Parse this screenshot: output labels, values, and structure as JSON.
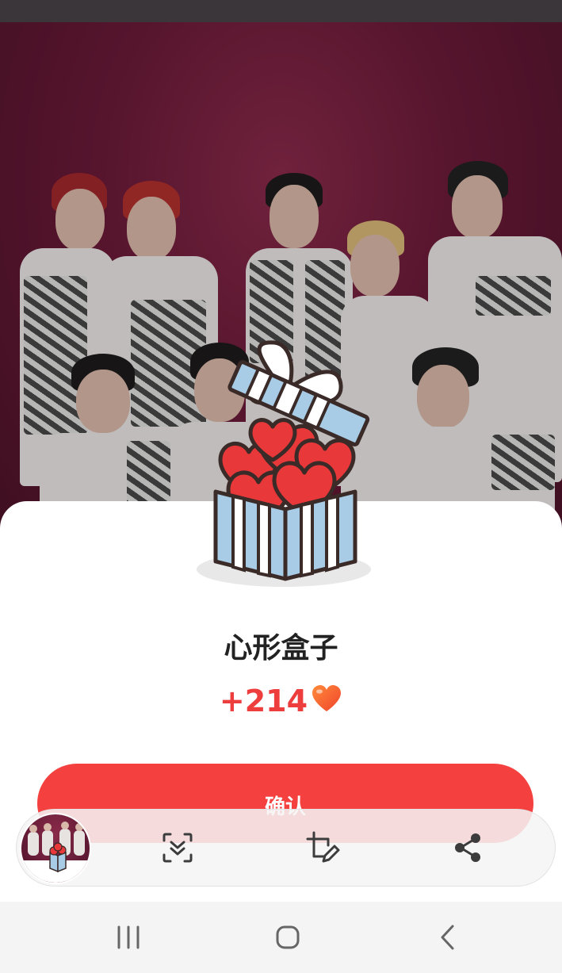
{
  "gift": {
    "name": "心形盒子",
    "reward": "+214"
  },
  "confirm_label": "确认",
  "toolbar": {
    "icons": [
      "scroll-capture-icon",
      "crop-edit-icon",
      "share-icon"
    ]
  },
  "navbar": {
    "icons": [
      "recents-icon",
      "home-icon",
      "back-icon"
    ]
  },
  "colors": {
    "accent": "#f4413f",
    "reward_text": "#ee3d3d",
    "box_blue": "#a8cce6",
    "heart_red": "#e8383a"
  }
}
